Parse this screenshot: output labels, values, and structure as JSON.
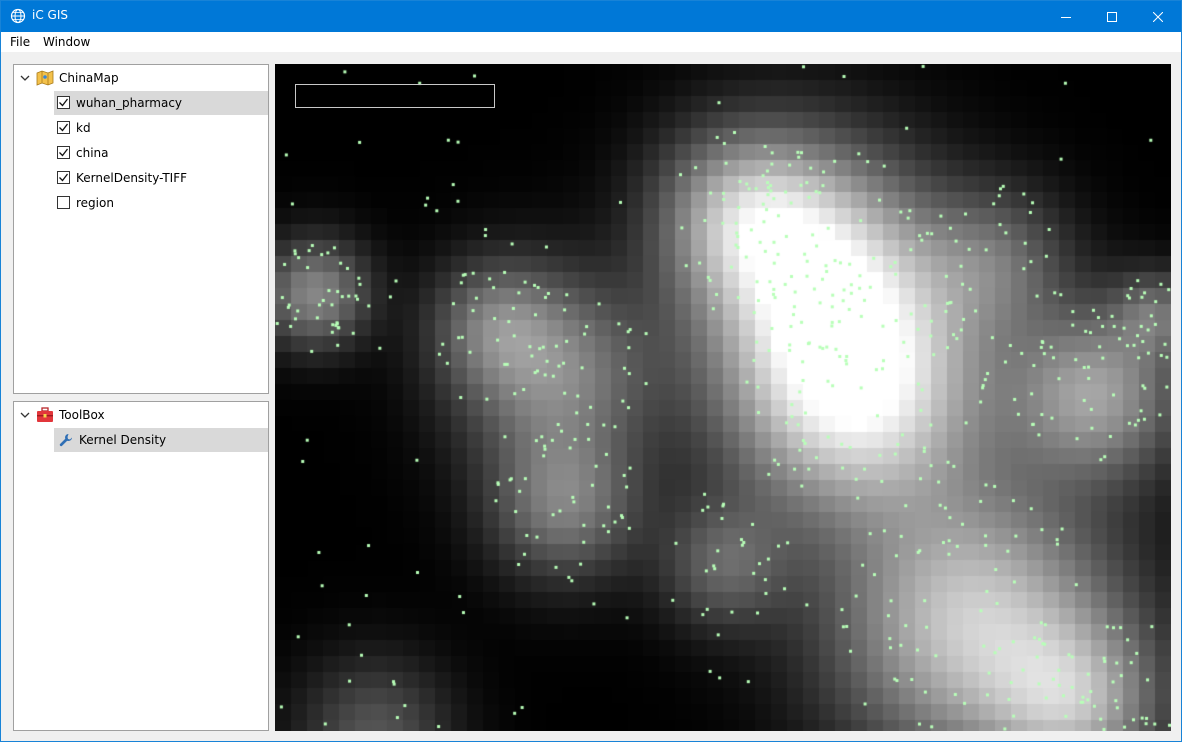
{
  "window": {
    "title": "iC GIS"
  },
  "menu": {
    "items": [
      {
        "label": "File"
      },
      {
        "label": "Window"
      }
    ]
  },
  "layers": {
    "group": {
      "label": "ChinaMap",
      "expanded": true
    },
    "items": [
      {
        "label": "wuhan_pharmacy",
        "checked": true,
        "selected": true
      },
      {
        "label": "kd",
        "checked": true,
        "selected": false
      },
      {
        "label": "china",
        "checked": true,
        "selected": false
      },
      {
        "label": "KernelDensity-TIFF",
        "checked": true,
        "selected": false
      },
      {
        "label": "region",
        "checked": false,
        "selected": false
      }
    ]
  },
  "toolbox": {
    "group": {
      "label": "ToolBox",
      "expanded": true
    },
    "items": [
      {
        "label": "Kernel Density",
        "selected": true
      }
    ]
  },
  "map": {
    "search_value": "",
    "point_color": "#b8ffb8",
    "density_peak_color": "#ffffff",
    "background_color": "#000000"
  },
  "colors": {
    "titlebar": "#0078d7",
    "selection": "#d9d9d9"
  }
}
